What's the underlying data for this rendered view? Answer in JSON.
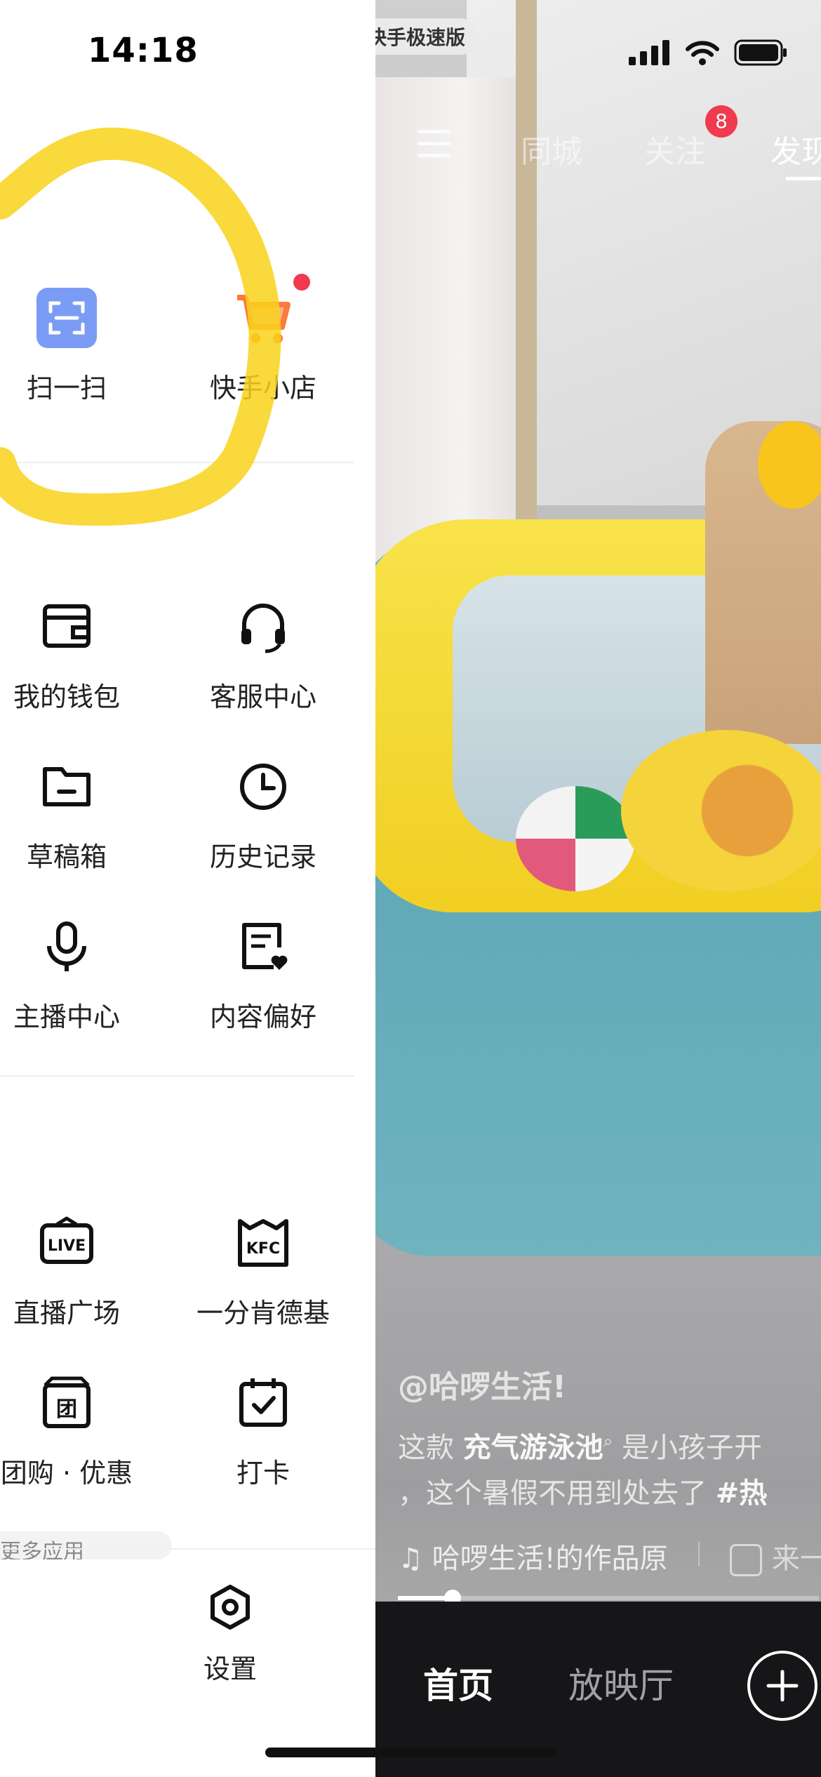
{
  "status_bar": {
    "time": "14:18",
    "app_pill": "快手极速版"
  },
  "drawer": {
    "top_items": [
      {
        "label": "扫一扫",
        "icon": "scan-icon"
      },
      {
        "label": "快手小店",
        "icon": "shopping-cart-icon",
        "has_dot": true
      }
    ],
    "tool_items": [
      {
        "label": "我的钱包",
        "icon": "wallet-icon"
      },
      {
        "label": "客服中心",
        "icon": "headset-icon"
      },
      {
        "label": "草稿箱",
        "icon": "folder-icon"
      },
      {
        "label": "历史记录",
        "icon": "clock-icon"
      },
      {
        "label": "主播中心",
        "icon": "microphone-icon"
      },
      {
        "label": "内容偏好",
        "icon": "preference-icon"
      }
    ],
    "service_items": [
      {
        "label": "直播广场",
        "icon": "live-icon"
      },
      {
        "label": "一分肯德基",
        "icon": "kfc-icon"
      },
      {
        "label": "团购 · 优惠",
        "icon": "group-buy-icon"
      },
      {
        "label": "打卡",
        "icon": "calendar-check-icon"
      }
    ],
    "more_apps_partial": "更多应用",
    "settings_label": "设置",
    "accent_color": "#7b9cf5",
    "cart_color": "#fb7a3c"
  },
  "video": {
    "top_tabs": {
      "tab1": "同城",
      "tab2": "关注",
      "tab3": "发现",
      "badge": "8"
    },
    "author": "@哈啰生活!",
    "desc_line1_pre": "这款 ",
    "desc_line1_bold": "充气游泳池",
    "desc_line1_post": " 是小孩子开",
    "desc_line2_pre": "，这个暑假不用到处去了 ",
    "desc_line2_tag": "#热",
    "music": "♫ 哈啰生活!的作品原",
    "music_extra": "来一",
    "progress": 0.13
  },
  "bottom_nav": {
    "home": "首页",
    "theater": "放映厅"
  }
}
